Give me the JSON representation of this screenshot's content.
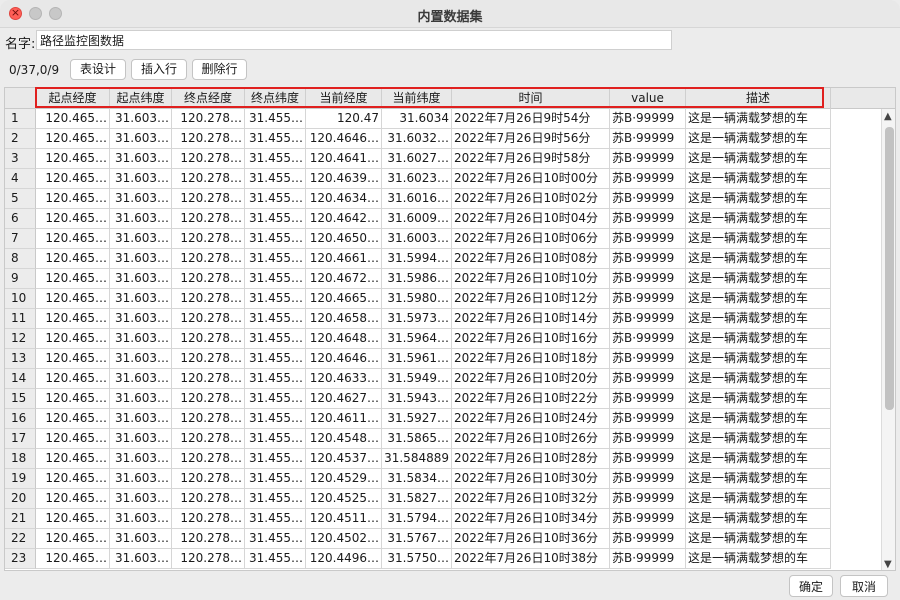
{
  "window": {
    "title": "内置数据集"
  },
  "form": {
    "name_label": "名字:",
    "name_value": "路径监控图数据"
  },
  "toolbar": {
    "counter": "0/37,0/9",
    "design_label": "表设计",
    "insert_label": "插入行",
    "delete_label": "删除行"
  },
  "table": {
    "columns": [
      "起点经度",
      "起点纬度",
      "终点经度",
      "终点纬度",
      "当前经度",
      "当前纬度",
      "时间",
      "value",
      "描述"
    ],
    "rows": [
      [
        "1",
        "120.465…",
        "31.603…",
        "120.278…",
        "31.455…",
        "120.47",
        "31.6034",
        "2022年7月26日9时54分",
        "苏B·99999",
        "这是一辆满载梦想的车"
      ],
      [
        "2",
        "120.465…",
        "31.603…",
        "120.278…",
        "31.455…",
        "120.4646…",
        "31.6032…",
        "2022年7月26日9时56分",
        "苏B·99999",
        "这是一辆满载梦想的车"
      ],
      [
        "3",
        "120.465…",
        "31.603…",
        "120.278…",
        "31.455…",
        "120.4641…",
        "31.6027…",
        "2022年7月26日9时58分",
        "苏B·99999",
        "这是一辆满载梦想的车"
      ],
      [
        "4",
        "120.465…",
        "31.603…",
        "120.278…",
        "31.455…",
        "120.4639…",
        "31.6023…",
        "2022年7月26日10时00分",
        "苏B·99999",
        "这是一辆满载梦想的车"
      ],
      [
        "5",
        "120.465…",
        "31.603…",
        "120.278…",
        "31.455…",
        "120.4634…",
        "31.6016…",
        "2022年7月26日10时02分",
        "苏B·99999",
        "这是一辆满载梦想的车"
      ],
      [
        "6",
        "120.465…",
        "31.603…",
        "120.278…",
        "31.455…",
        "120.4642…",
        "31.6009…",
        "2022年7月26日10时04分",
        "苏B·99999",
        "这是一辆满载梦想的车"
      ],
      [
        "7",
        "120.465…",
        "31.603…",
        "120.278…",
        "31.455…",
        "120.4650…",
        "31.6003…",
        "2022年7月26日10时06分",
        "苏B·99999",
        "这是一辆满载梦想的车"
      ],
      [
        "8",
        "120.465…",
        "31.603…",
        "120.278…",
        "31.455…",
        "120.4661…",
        "31.5994…",
        "2022年7月26日10时08分",
        "苏B·99999",
        "这是一辆满载梦想的车"
      ],
      [
        "9",
        "120.465…",
        "31.603…",
        "120.278…",
        "31.455…",
        "120.4672…",
        "31.5986…",
        "2022年7月26日10时10分",
        "苏B·99999",
        "这是一辆满载梦想的车"
      ],
      [
        "10",
        "120.465…",
        "31.603…",
        "120.278…",
        "31.455…",
        "120.4665…",
        "31.5980…",
        "2022年7月26日10时12分",
        "苏B·99999",
        "这是一辆满载梦想的车"
      ],
      [
        "11",
        "120.465…",
        "31.603…",
        "120.278…",
        "31.455…",
        "120.4658…",
        "31.5973…",
        "2022年7月26日10时14分",
        "苏B·99999",
        "这是一辆满载梦想的车"
      ],
      [
        "12",
        "120.465…",
        "31.603…",
        "120.278…",
        "31.455…",
        "120.4648…",
        "31.5964…",
        "2022年7月26日10时16分",
        "苏B·99999",
        "这是一辆满载梦想的车"
      ],
      [
        "13",
        "120.465…",
        "31.603…",
        "120.278…",
        "31.455…",
        "120.4646…",
        "31.5961…",
        "2022年7月26日10时18分",
        "苏B·99999",
        "这是一辆满载梦想的车"
      ],
      [
        "14",
        "120.465…",
        "31.603…",
        "120.278…",
        "31.455…",
        "120.4633…",
        "31.5949…",
        "2022年7月26日10时20分",
        "苏B·99999",
        "这是一辆满载梦想的车"
      ],
      [
        "15",
        "120.465…",
        "31.603…",
        "120.278…",
        "31.455…",
        "120.4627…",
        "31.5943…",
        "2022年7月26日10时22分",
        "苏B·99999",
        "这是一辆满载梦想的车"
      ],
      [
        "16",
        "120.465…",
        "31.603…",
        "120.278…",
        "31.455…",
        "120.4611…",
        "31.5927…",
        "2022年7月26日10时24分",
        "苏B·99999",
        "这是一辆满载梦想的车"
      ],
      [
        "17",
        "120.465…",
        "31.603…",
        "120.278…",
        "31.455…",
        "120.4548…",
        "31.5865…",
        "2022年7月26日10时26分",
        "苏B·99999",
        "这是一辆满载梦想的车"
      ],
      [
        "18",
        "120.465…",
        "31.603…",
        "120.278…",
        "31.455…",
        "120.4537…",
        "31.584889",
        "2022年7月26日10时28分",
        "苏B·99999",
        "这是一辆满载梦想的车"
      ],
      [
        "19",
        "120.465…",
        "31.603…",
        "120.278…",
        "31.455…",
        "120.4529…",
        "31.5834…",
        "2022年7月26日10时30分",
        "苏B·99999",
        "这是一辆满载梦想的车"
      ],
      [
        "20",
        "120.465…",
        "31.603…",
        "120.278…",
        "31.455…",
        "120.4525…",
        "31.5827…",
        "2022年7月26日10时32分",
        "苏B·99999",
        "这是一辆满载梦想的车"
      ],
      [
        "21",
        "120.465…",
        "31.603…",
        "120.278…",
        "31.455…",
        "120.4511…",
        "31.5794…",
        "2022年7月26日10时34分",
        "苏B·99999",
        "这是一辆满载梦想的车"
      ],
      [
        "22",
        "120.465…",
        "31.603…",
        "120.278…",
        "31.455…",
        "120.4502…",
        "31.5767…",
        "2022年7月26日10时36分",
        "苏B·99999",
        "这是一辆满载梦想的车"
      ],
      [
        "23",
        "120.465…",
        "31.603…",
        "120.278…",
        "31.455…",
        "120.4496…",
        "31.5750…",
        "2022年7月26日10时38分",
        "苏B·99999",
        "这是一辆满载梦想的车"
      ]
    ]
  },
  "footer": {
    "ok_label": "确定",
    "cancel_label": "取消"
  },
  "icons": {
    "close": "close-icon",
    "scroll_up": "chevron-up-icon",
    "scroll_down": "chevron-down-icon"
  },
  "colors": {
    "highlight": "#e0201f",
    "close": "#ff5f57"
  }
}
